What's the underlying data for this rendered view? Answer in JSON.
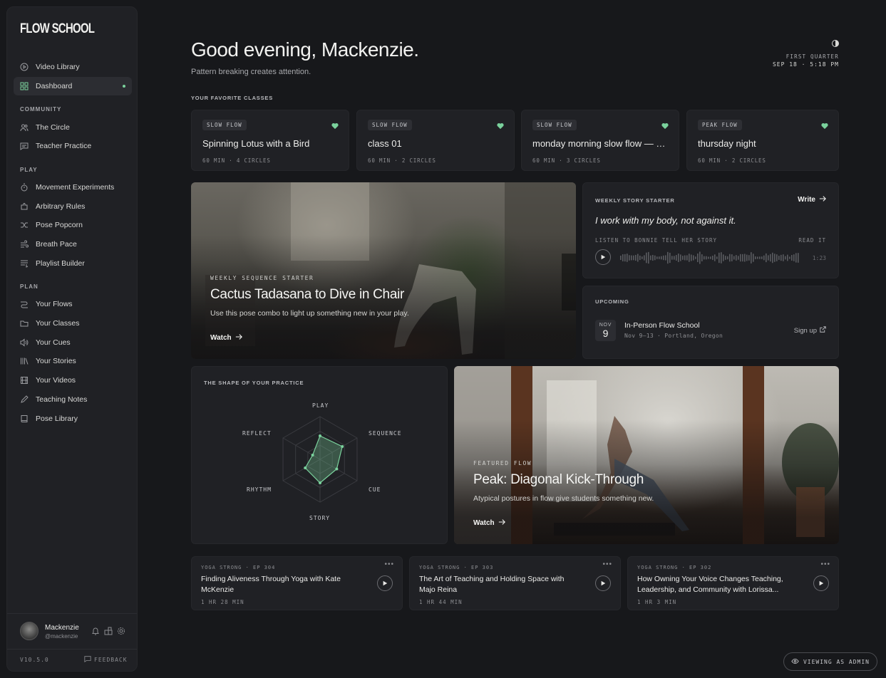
{
  "app": {
    "logo": "FLOW SCHOOL"
  },
  "sidebar": {
    "items_top": [
      {
        "label": "Video Library",
        "icon": "play-circle-icon"
      },
      {
        "label": "Dashboard",
        "icon": "dashboard-grid-icon",
        "active": true
      }
    ],
    "sections": [
      {
        "title": "COMMUNITY",
        "items": [
          {
            "label": "The Circle",
            "icon": "users-icon"
          },
          {
            "label": "Teacher Practice",
            "icon": "chat-icon"
          }
        ]
      },
      {
        "title": "PLAY",
        "items": [
          {
            "label": "Movement Experiments",
            "icon": "timer-icon"
          },
          {
            "label": "Arbitrary Rules",
            "icon": "puzzle-icon"
          },
          {
            "label": "Pose Popcorn",
            "icon": "shuffle-icon"
          },
          {
            "label": "Breath Pace",
            "icon": "wind-icon"
          },
          {
            "label": "Playlist Builder",
            "icon": "playlist-icon"
          }
        ]
      },
      {
        "title": "PLAN",
        "items": [
          {
            "label": "Your Flows",
            "icon": "flow-icon"
          },
          {
            "label": "Your Classes",
            "icon": "folder-icon"
          },
          {
            "label": "Your Cues",
            "icon": "speaker-icon"
          },
          {
            "label": "Your Stories",
            "icon": "library-icon"
          },
          {
            "label": "Your Videos",
            "icon": "film-icon"
          },
          {
            "label": "Teaching Notes",
            "icon": "pencil-icon"
          },
          {
            "label": "Pose Library",
            "icon": "book-icon"
          }
        ]
      }
    ],
    "user": {
      "name": "Mackenzie",
      "handle": "@mackenzie"
    },
    "version": "V10.5.0",
    "feedback": "FEEDBACK"
  },
  "header": {
    "greeting": "Good evening, Mackenzie.",
    "subline": "Pattern breaking creates attention.",
    "moon_phase": "FIRST QUARTER",
    "date_time": "SEP 18 · 5:18 PM"
  },
  "favorites": {
    "label": "YOUR FAVORITE CLASSES",
    "cards": [
      {
        "badge": "SLOW FLOW",
        "title": "Spinning Lotus with a Bird",
        "meta": "60 MIN · 4 CIRCLES"
      },
      {
        "badge": "SLOW FLOW",
        "title": "class 01",
        "meta": "60 MIN · 2 CIRCLES"
      },
      {
        "badge": "SLOW FLOW",
        "title": "monday morning slow flow — c...",
        "meta": "60 MIN · 3 CIRCLES"
      },
      {
        "badge": "PEAK FLOW",
        "title": "thursday night",
        "meta": "60 MIN · 2 CIRCLES"
      }
    ]
  },
  "sequence_hero": {
    "kicker": "WEEKLY SEQUENCE STARTER",
    "title": "Cactus Tadasana to Dive in Chair",
    "desc": "Use this pose combo to light up something new in your play.",
    "cta": "Watch"
  },
  "story": {
    "kicker": "WEEKLY STORY STARTER",
    "write": "Write",
    "quote": "I work with my body, not against it.",
    "listen": "LISTEN TO BONNIE TELL HER STORY",
    "read": "READ IT",
    "duration": "1:23"
  },
  "upcoming": {
    "kicker": "UPCOMING",
    "month": "NOV",
    "day": "9",
    "title": "In-Person Flow School",
    "meta": "Nov 9–13 · Portland, Oregon",
    "cta": "Sign up"
  },
  "practice_shape": {
    "label": "THE SHAPE OF YOUR PRACTICE",
    "axes": [
      "PLAY",
      "SEQUENCE",
      "CUE",
      "STORY",
      "RHYTHM",
      "REFLECT"
    ],
    "values": [
      0.55,
      0.6,
      0.45,
      0.55,
      0.4,
      0.2
    ],
    "accent": "#7ad19c"
  },
  "featured_hero": {
    "kicker": "FEATURED FLOW",
    "title": "Peak: Diagonal Kick-Through",
    "desc": "Atypical postures in flow give students something new.",
    "cta": "Watch"
  },
  "podcasts": [
    {
      "kicker": "YOGA STRONG · EP 304",
      "title": "Finding Aliveness Through Yoga with Kate McKenzie",
      "time": "1 HR 28 MIN"
    },
    {
      "kicker": "YOGA STRONG · EP 303",
      "title": "The Art of Teaching and Holding Space with Majo Reina",
      "time": "1 HR 44 MIN"
    },
    {
      "kicker": "YOGA STRONG · EP 302",
      "title": "How Owning Your Voice Changes Teaching, Leadership, and Community with Lorissa...",
      "time": "1 HR 3 MIN"
    }
  ],
  "admin_chip": "VIEWING AS ADMIN"
}
